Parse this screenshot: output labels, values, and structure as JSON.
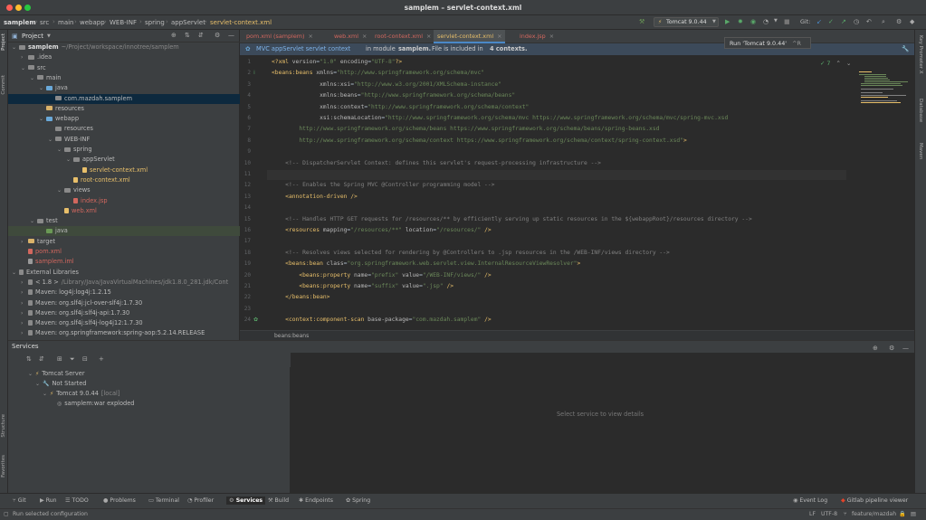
{
  "window": {
    "title": "samplem – servlet-context.xml"
  },
  "breadcrumbs": [
    "samplem",
    "src",
    "main",
    "webapp",
    "WEB-INF",
    "spring",
    "appServlet",
    "servlet-context.xml"
  ],
  "toolbar": {
    "run_config": "Tomcat 9.0.44",
    "git_label": "Git:"
  },
  "left_strip": {
    "project": "Project",
    "commit": "Commit",
    "structure": "Structure",
    "favorites": "Favorites"
  },
  "right_strip": {
    "key_promoter": "Key Promoter X",
    "database": "Database",
    "maven": "Maven"
  },
  "project_panel": {
    "title": "Project"
  },
  "tree": [
    {
      "label": "samplem",
      "suffix": "~/Project/workspace/innotree/samplem",
      "depth": 0,
      "arrow": "down",
      "icon": "folder",
      "color": "bold"
    },
    {
      "label": ".idea",
      "depth": 1,
      "arrow": "right",
      "icon": "folder"
    },
    {
      "label": "src",
      "depth": 1,
      "arrow": "down",
      "icon": "folder"
    },
    {
      "label": "main",
      "depth": 2,
      "arrow": "down",
      "icon": "folder"
    },
    {
      "label": "java",
      "depth": 3,
      "arrow": "down",
      "icon": "folder-blue"
    },
    {
      "label": "com.mazdah.samplem",
      "depth": 4,
      "arrow": "",
      "icon": "folder",
      "selected": true
    },
    {
      "label": "resources",
      "depth": 3,
      "arrow": "",
      "icon": "folder-yellow"
    },
    {
      "label": "webapp",
      "depth": 3,
      "arrow": "down",
      "icon": "folder-blue"
    },
    {
      "label": "resources",
      "depth": 4,
      "arrow": "",
      "icon": "folder"
    },
    {
      "label": "WEB-INF",
      "depth": 4,
      "arrow": "down",
      "icon": "folder"
    },
    {
      "label": "spring",
      "depth": 5,
      "arrow": "down",
      "icon": "folder"
    },
    {
      "label": "appServlet",
      "depth": 6,
      "arrow": "down",
      "icon": "folder"
    },
    {
      "label": "servlet-context.xml",
      "depth": 7,
      "arrow": "",
      "icon": "xml",
      "color": "xml"
    },
    {
      "label": "root-context.xml",
      "depth": 6,
      "arrow": "",
      "icon": "xml",
      "color": "xml"
    },
    {
      "label": "views",
      "depth": 5,
      "arrow": "down",
      "icon": "folder"
    },
    {
      "label": "index.jsp",
      "depth": 6,
      "arrow": "",
      "icon": "jsp",
      "color": "jsp"
    },
    {
      "label": "web.xml",
      "depth": 5,
      "arrow": "",
      "icon": "xml",
      "color": "jsp"
    },
    {
      "label": "test",
      "depth": 2,
      "arrow": "down",
      "icon": "folder"
    },
    {
      "label": "java",
      "depth": 3,
      "arrow": "",
      "icon": "folder-green",
      "highlight": true
    },
    {
      "label": "target",
      "depth": 1,
      "arrow": "right",
      "icon": "folder-yellow"
    },
    {
      "label": "pom.xml",
      "depth": 1,
      "arrow": "",
      "icon": "maven",
      "color": "maven"
    },
    {
      "label": "samplem.iml",
      "depth": 1,
      "arrow": "",
      "icon": "iml",
      "color": "maven"
    },
    {
      "label": "External Libraries",
      "depth": 0,
      "arrow": "down",
      "icon": "lib"
    },
    {
      "label": "< 1.8 >",
      "suffix": "/Library/Java/JavaVirtualMachines/jdk1.8.0_281.jdk/Cont",
      "depth": 1,
      "arrow": "right",
      "icon": "lib"
    },
    {
      "label": "Maven: log4j:log4j:1.2.15",
      "depth": 1,
      "arrow": "right",
      "icon": "lib"
    },
    {
      "label": "Maven: org.slf4j:jcl-over-slf4j:1.7.30",
      "depth": 1,
      "arrow": "right",
      "icon": "lib"
    },
    {
      "label": "Maven: org.slf4j:slf4j-api:1.7.30",
      "depth": 1,
      "arrow": "right",
      "icon": "lib"
    },
    {
      "label": "Maven: org.slf4j:slf4j-log4j12:1.7.30",
      "depth": 1,
      "arrow": "right",
      "icon": "lib"
    },
    {
      "label": "Maven: org.springframework:spring-aop:5.2.14.RELEASE",
      "depth": 1,
      "arrow": "right",
      "icon": "lib"
    }
  ],
  "editor_tabs": [
    {
      "label": "pom.xml (samplem)",
      "color": "#d2675e"
    },
    {
      "label": "web.xml",
      "color": "#d2675e"
    },
    {
      "label": "root-context.xml",
      "color": "#d2675e"
    },
    {
      "label": "servlet-context.xml",
      "color": "#e8bf6a",
      "active": true
    },
    {
      "label": "index.jsp",
      "color": "#d2675e"
    }
  ],
  "banner": {
    "context": "MVC appServlet servlet context",
    "message": "in module",
    "module": "samplem.",
    "message2": "File is included in",
    "contexts": "4 contexts."
  },
  "inspection": {
    "count": "7"
  },
  "tooltip": {
    "text": "Run 'Tomcat 9.0.44'",
    "shortcut": "^R"
  },
  "code_lines": [
    {
      "n": "1",
      "html": "<span class='t'>&lt;?xml </span><span class='a'>version</span>=<span class='s'>\"1.0\"</span> <span class='a'>encoding</span>=<span class='s'>\"UTF-8\"</span><span class='t'>?&gt;</span>"
    },
    {
      "n": "2",
      "html": "<span class='t'>&lt;beans:beans </span><span class='a'>xmlns</span>=<span class='s'>\"http://www.springframework.org/schema/mvc\"</span>"
    },
    {
      "n": "3",
      "html": "              <span class='a'>xmlns:xsi</span>=<span class='s'>\"http://www.w3.org/2001/XMLSchema-instance\"</span>"
    },
    {
      "n": "4",
      "html": "              <span class='a'>xmlns:beans</span>=<span class='s'>\"http://www.springframework.org/schema/beans\"</span>"
    },
    {
      "n": "5",
      "html": "              <span class='a'>xmlns:context</span>=<span class='s'>\"http://www.springframework.org/schema/context\"</span>"
    },
    {
      "n": "6",
      "html": "              <span class='a'>xsi:schemaLocation</span>=<span class='s'>\"http://www.springframework.org/schema/mvc https://www.springframework.org/schema/mvc/spring-mvc.xsd</span>"
    },
    {
      "n": "7",
      "html": "        <span class='s'>http://www.springframework.org/schema/beans https://www.springframework.org/schema/beans/spring-beans.xsd</span>"
    },
    {
      "n": "8",
      "html": "        <span class='s'>http://www.springframework.org/schema/context https://www.springframework.org/schema/context/spring-context.xsd\"</span><span class='t'>&gt;</span>"
    },
    {
      "n": "9",
      "html": ""
    },
    {
      "n": "10",
      "html": "    <span class='c'>&lt;!-- DispatcherServlet Context: defines this servlet's request-processing infrastructure --&gt;</span>"
    },
    {
      "n": "11",
      "html": "",
      "hl": true
    },
    {
      "n": "12",
      "html": "    <span class='c'>&lt;!-- Enables the Spring MVC @Controller programming model --&gt;</span>"
    },
    {
      "n": "13",
      "html": "    <span class='t'>&lt;annotation-driven /&gt;</span>"
    },
    {
      "n": "14",
      "html": ""
    },
    {
      "n": "15",
      "html": "    <span class='c'>&lt;!-- Handles HTTP GET requests for /resources/** by efficiently serving up static resources in the ${webappRoot}/resources directory --&gt;</span>"
    },
    {
      "n": "16",
      "html": "    <span class='t'>&lt;resources </span><span class='a'>mapping</span>=<span class='s'>\"/resources/**\"</span> <span class='a'>location</span>=<span class='s'>\"/resources/\"</span> <span class='t'>/&gt;</span>"
    },
    {
      "n": "17",
      "html": ""
    },
    {
      "n": "18",
      "html": "    <span class='c'>&lt;!-- Resolves views selected for rendering by @Controllers to .jsp resources in the /WEB-INF/views directory --&gt;</span>"
    },
    {
      "n": "19",
      "html": "    <span class='t'>&lt;beans:bean </span><span class='a'>class</span>=<span class='s'>\"org.springframework.web.servlet.view.InternalResourceViewResolver\"</span><span class='t'>&gt;</span>"
    },
    {
      "n": "20",
      "html": "        <span class='t'>&lt;beans:property </span><span class='a'>name</span>=<span class='s'>\"prefix\"</span> <span class='a'>value</span>=<span class='s'>\"/WEB-INF/views/\"</span> <span class='t'>/&gt;</span>"
    },
    {
      "n": "21",
      "html": "        <span class='t'>&lt;beans:property </span><span class='a'>name</span>=<span class='s'>\"suffix\"</span> <span class='a'>value</span>=<span class='s'>\".jsp\"</span> <span class='t'>/&gt;</span>"
    },
    {
      "n": "22",
      "html": "    <span class='t'>&lt;/beans:bean&gt;</span>"
    },
    {
      "n": "23",
      "html": ""
    },
    {
      "n": "24",
      "html": "    <span class='t'>&lt;context:component-scan </span><span class='a'>base-package</span>=<span class='s'>\"com.mazdah.samplem\"</span> <span class='t'>/&gt;</span>"
    }
  ],
  "editor_breadcrumb": "beans:beans",
  "services": {
    "title": "Services",
    "tree": [
      {
        "label": "Tomcat Server",
        "depth": 1
      },
      {
        "label": "Not Started",
        "depth": 2
      },
      {
        "label": "Tomcat 9.0.44",
        "suffix": "[local]",
        "depth": 3
      },
      {
        "label": "samplem:war exploded",
        "depth": 4
      }
    ],
    "empty_text": "Select service to view details"
  },
  "tool_windows": [
    "Git",
    "Run",
    "TODO",
    "Problems",
    "Terminal",
    "Profiler",
    "Services",
    "Build",
    "Endpoints",
    "Spring"
  ],
  "tool_windows_right": [
    "Event Log",
    "Gitlab pipeline viewer"
  ],
  "status": {
    "message": "Run selected configuration",
    "line_sep": "LF",
    "encoding": "UTF-8",
    "branch": "feature/mazdah"
  },
  "colors": {
    "accent": "#4a88c7",
    "bg_panel": "#3c3f41",
    "bg_editor": "#2b2b2b",
    "selection": "#0d293e"
  }
}
